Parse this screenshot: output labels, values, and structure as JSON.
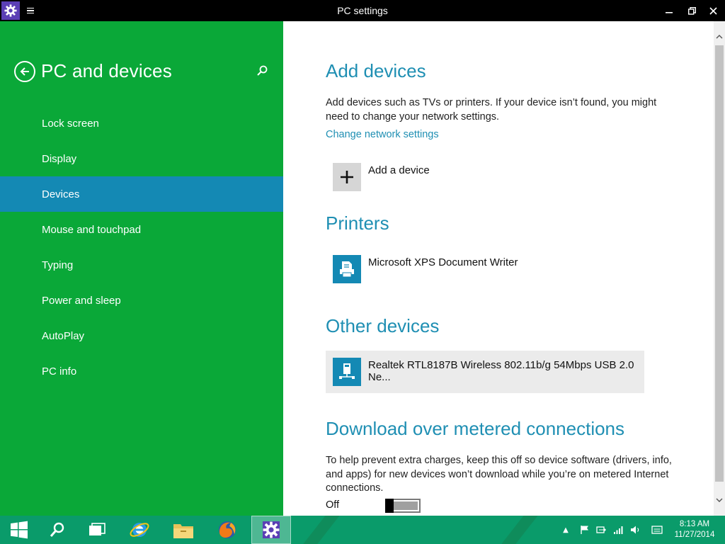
{
  "window": {
    "title": "PC settings",
    "minimize": "—",
    "restore": "❐",
    "close": "✕"
  },
  "nav": {
    "section_title": "PC and devices",
    "items": [
      {
        "label": "Lock screen",
        "active": false
      },
      {
        "label": "Display",
        "active": false
      },
      {
        "label": "Devices",
        "active": true
      },
      {
        "label": "Mouse and touchpad",
        "active": false
      },
      {
        "label": "Typing",
        "active": false
      },
      {
        "label": "Power and sleep",
        "active": false
      },
      {
        "label": "AutoPlay",
        "active": false
      },
      {
        "label": "PC info",
        "active": false
      }
    ]
  },
  "content": {
    "add_devices": {
      "heading": "Add devices",
      "description": "Add devices such as TVs or printers. If your device isn’t found, you might need to change your network settings.",
      "link": "Change network settings",
      "add_label": "Add a device"
    },
    "printers": {
      "heading": "Printers",
      "items": [
        "Microsoft XPS Document Writer"
      ]
    },
    "other_devices": {
      "heading": "Other devices",
      "items": [
        "Realtek RTL8187B Wireless 802.11b/g 54Mbps USB 2.0 Ne..."
      ]
    },
    "metered": {
      "heading": "Download over metered connections",
      "description": "To help prevent extra charges, keep this off so device software (drivers, info, and apps) for new devices won’t download while you’re on metered Internet connections.",
      "toggle_label": "Off",
      "toggle_on": false
    }
  },
  "taskbar": {
    "clock_time": "8:13 AM",
    "clock_date": "11/27/2014",
    "tray_overflow": "▲"
  },
  "colors": {
    "nav_bg": "#0aa838",
    "nav_active": "#1489b4",
    "accent": "#1f8fb3",
    "taskbar": "#0a9b6a",
    "app_icon": "#5b3fb5"
  }
}
